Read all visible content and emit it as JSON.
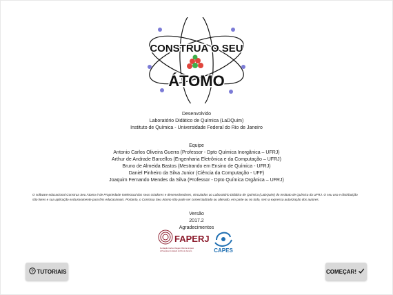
{
  "logo": {
    "line1": "CONSTRUA O SEU",
    "line2": "ÁTOMO"
  },
  "developed": {
    "heading": "Desenvolvido",
    "lines": [
      "Laboratório Didático de Química (LaDQuim)",
      "Instituto de Química - Universidade Federal do Rio de Janeiro"
    ]
  },
  "team": {
    "heading": "Equipe",
    "members": [
      "Antonio Carlos Oliveira Guerra (Professor - Dpto Química Inorgânica – UFRJ)",
      "Arthur de Andrade Barcellos (Engenharia Eletrônica e da Computação – UFRJ)",
      "Bruno de Almeida Bastos (Mestrando em Ensino de Química - UFRJ)",
      "Daniel Pinheiro da Silva Junior (Ciência da Computação - UFF)",
      "Joaquim Fernando Mendes da Silva (Professor - Dpto Química Orgânica – UFRJ)"
    ]
  },
  "legal_text": "O software educacional Construa Seu Átomo é de Propriedade Intelectual dos seus criadores e desenvolvedores, vinculados ao Laboratório Didático de Química (LaDQuim) do Instituto de Química da UFRJ. O seu uso e distribuição são livres e sua aplicação exclusivamente para fins educacionais. Portanto, o Construa Seu Átomo não pode ser comercializado ou alterado, em parte ou no todo, sem a expressa autorização dos autores.",
  "version": {
    "label": "Versão",
    "number": "2017.2",
    "thanks": "Agradecimentos"
  },
  "sponsors": {
    "faperj": "FAPERJ",
    "faperj_sub1": "Fundação Carlos Chagas Filho de Amparo",
    "faperj_sub2": "à Pesquisa do Estado do Rio de Janeiro",
    "capes": "CAPES"
  },
  "buttons": {
    "tutorials": "TUTORIAIS",
    "start": "COMEÇAR!"
  },
  "colors": {
    "electron": "#7b7bd6",
    "proton": "#e0463c",
    "neutron": "#3fae4a",
    "faperj": "#8b1a2b",
    "capes": "#1f6fb2",
    "button_bg": "#d9d9d9"
  },
  "icons": {
    "tutorials": "question-circle-icon",
    "start": "checkmark-icon"
  }
}
